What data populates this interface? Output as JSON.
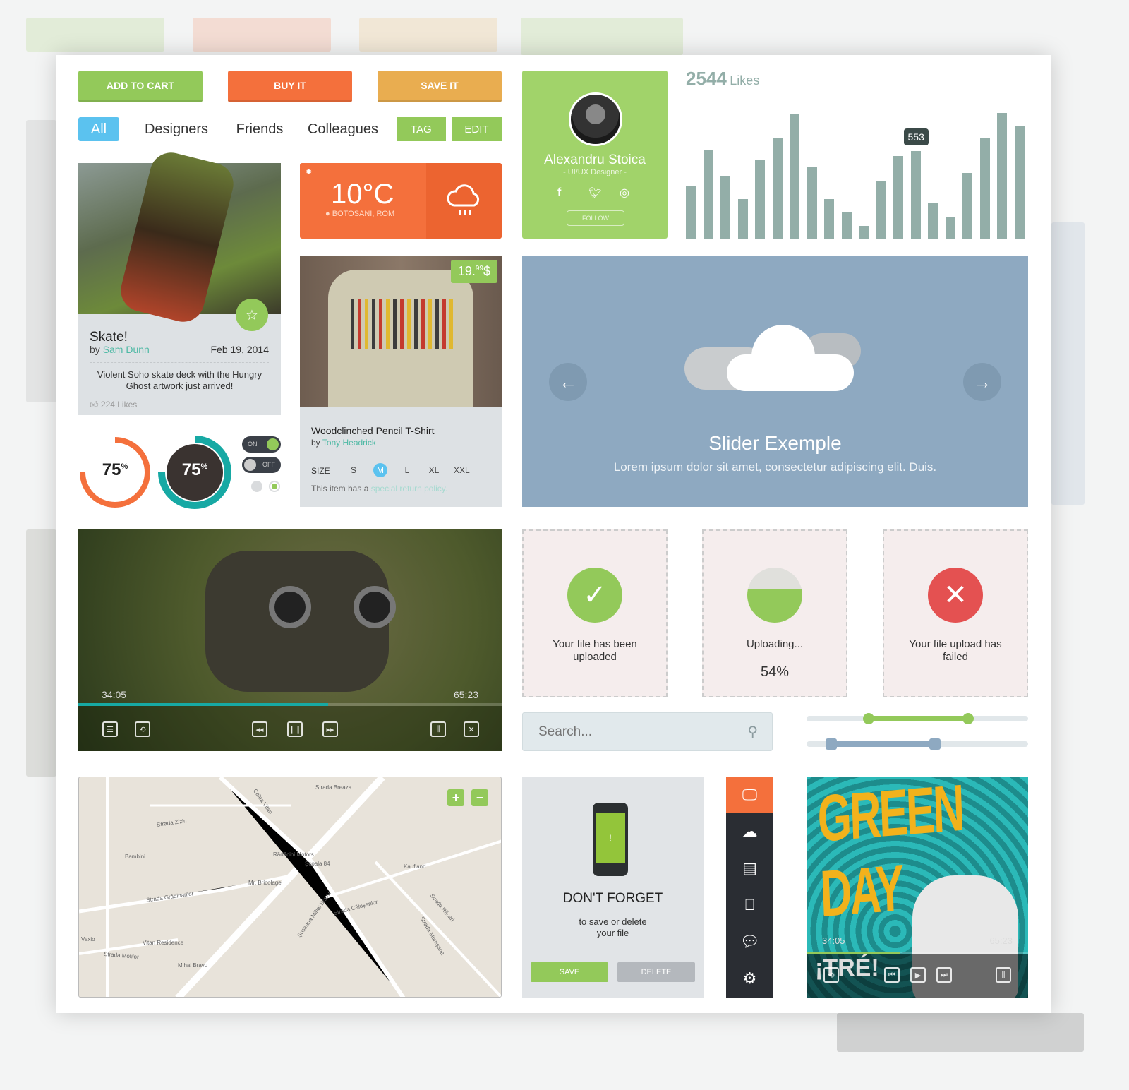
{
  "buttons": {
    "add_to_cart": "ADD TO CART",
    "buy_it": "BUY IT",
    "save_it": "SAVE IT"
  },
  "filters": {
    "all": "All",
    "designers": "Designers",
    "friends": "Friends",
    "colleagues": "Colleagues",
    "tag": "TAG",
    "edit": "EDIT"
  },
  "skate_card": {
    "title": "Skate!",
    "by": "by",
    "author": "Sam Dunn",
    "date": "Feb 19, 2014",
    "description": "Violent Soho skate deck with the Hungry Ghost artwork just arrived!",
    "likes": "224 Likes"
  },
  "weather": {
    "temperature": "10°C",
    "location": "BOTOSANI, ROM"
  },
  "tshirt": {
    "price_main": "19.",
    "price_cents": "99",
    "price_currency": "$",
    "title": "Woodclinched Pencil T-Shirt",
    "by": "by",
    "author": "Tony Headrick",
    "size_label": "SIZE",
    "sizes": [
      "S",
      "M",
      "L",
      "XL",
      "XXL"
    ],
    "selected_size": "M",
    "policy_prefix": "This item has a",
    "policy_link": "special return policy."
  },
  "progress": {
    "ring1_value": "75",
    "ring2_value": "75",
    "unit": "%",
    "fraction": 0.75
  },
  "toggles": {
    "on": "ON",
    "off": "OFF"
  },
  "profile": {
    "name": "Alexandru Stoica",
    "role": "- UI/UX Designer -",
    "follow": "FOLLOW"
  },
  "likes_chart": {
    "count": "2544",
    "label": "Likes",
    "tooltip": "553"
  },
  "chart_data": {
    "type": "bar",
    "title": "2544 Likes",
    "values": [
      218,
      366,
      262,
      163,
      327,
      415,
      516,
      297,
      163,
      108,
      53,
      238,
      342,
      362,
      150,
      90,
      271,
      419,
      521,
      467
    ],
    "highlight_index": 13,
    "highlight_label": "553",
    "grid": false
  },
  "slider": {
    "title": "Slider Exemple",
    "subtitle": "Lorem ipsum dolor sit amet, consectetur adipiscing elit. Duis."
  },
  "video": {
    "current": "34:05",
    "total": "65:23",
    "progress": 0.59
  },
  "uploads": [
    {
      "text": "Your file has been uploaded",
      "status": "success"
    },
    {
      "text": "Uploading...",
      "percent": "54%",
      "status": "uploading"
    },
    {
      "text": "Your file upload has failed",
      "status": "failed"
    }
  ],
  "search": {
    "placeholder": "Search..."
  },
  "range_sliders": {
    "green_range": [
      0.28,
      0.73
    ],
    "blue_range": [
      0.11,
      0.58
    ]
  },
  "map": {
    "zoom_in": "+",
    "zoom_out": "−",
    "labels": [
      "Strada Breaza",
      "Calea Vitan",
      "Strada Zizin",
      "Bambini",
      "Rădăcini Motors",
      "Școala 84",
      "Kaufland",
      "Mr. Bricolage",
      "Strada Grădinarilor",
      "Șoseaua Mihai Bravu",
      "Strada Călușarilor",
      "Vexio",
      "Vitan Residence",
      "Strada Motilor",
      "Mihai Bravu",
      "Strada Răcari",
      "Strada Mureșana"
    ]
  },
  "reminder": {
    "title": "DON'T FORGET",
    "text_line1": "to save or delete",
    "text_line2": "your file",
    "save": "SAVE",
    "delete": "DELETE"
  },
  "sidebar_icons": [
    "monitor-icon",
    "cloud-icon",
    "news-icon",
    "inbox-icon",
    "chat-icon",
    "gear-icon"
  ],
  "album": {
    "artist": "GREEN DAY",
    "title": "¡TRÉ!",
    "current": "34:05",
    "total": "65:23",
    "progress": 0.42
  },
  "colors": {
    "green": "#93c95a",
    "orange": "#f4703c",
    "amber": "#e9ad50",
    "blue": "#5bc2ef",
    "teal": "#17a9a4",
    "slate": "#8ea9c1",
    "bars": "#93aea8"
  }
}
